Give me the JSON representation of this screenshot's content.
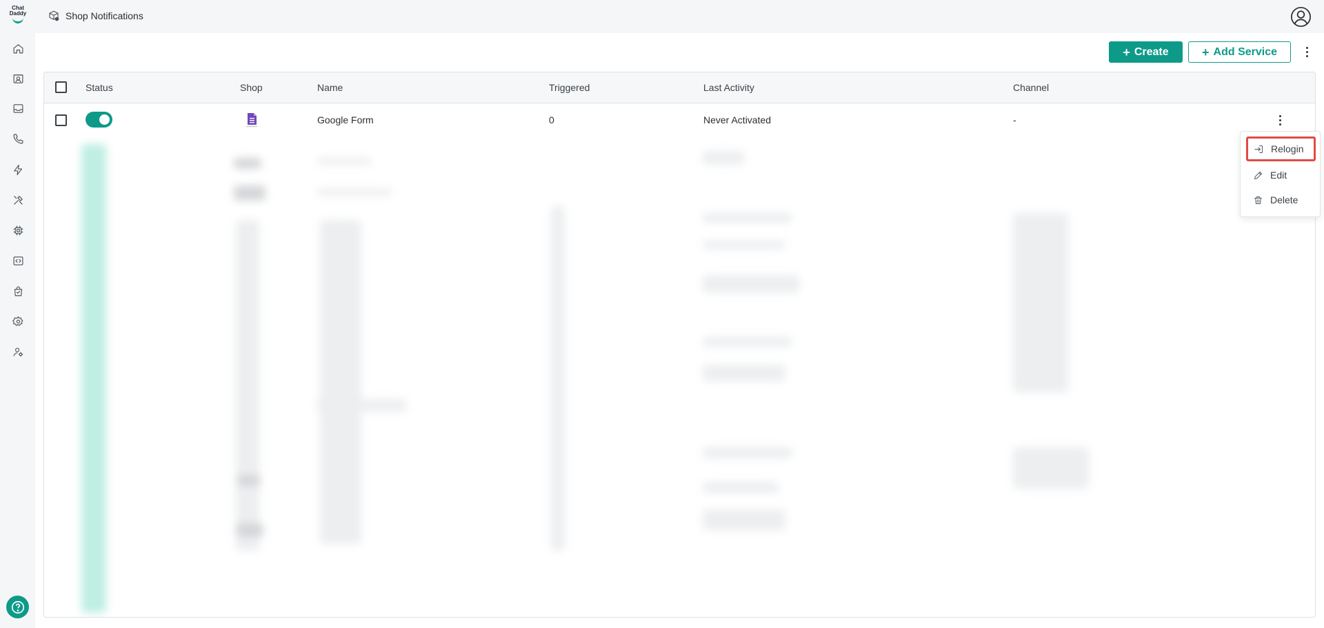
{
  "brand": {
    "logo_line1": "Chat",
    "logo_line2": "Daddy",
    "accent": "#0e9a88"
  },
  "sidebar": {
    "items": [
      {
        "name": "home-icon"
      },
      {
        "name": "contacts-icon"
      },
      {
        "name": "inbox-icon"
      },
      {
        "name": "phone-icon"
      },
      {
        "name": "automation-icon"
      },
      {
        "name": "tools-icon"
      },
      {
        "name": "chip-icon"
      },
      {
        "name": "code-icon"
      },
      {
        "name": "shop-bag-icon"
      },
      {
        "name": "settings-icon"
      },
      {
        "name": "team-icon"
      }
    ],
    "help": "help-icon"
  },
  "header": {
    "title": "Shop Notifications"
  },
  "toolbar": {
    "create_label": "Create",
    "add_service_label": "Add Service"
  },
  "table": {
    "columns": [
      "Status",
      "Shop",
      "Name",
      "Triggered",
      "Last Activity",
      "Channel"
    ],
    "rows": [
      {
        "status": "enabled",
        "shop": "Google Form",
        "name": "Google Form",
        "triggered": "0",
        "last_activity": "Never Activated",
        "channel": "-"
      }
    ]
  },
  "row_menu": {
    "items": [
      {
        "label": "Relogin",
        "icon": "relogin-icon",
        "highlighted": true
      },
      {
        "label": "Edit",
        "icon": "edit-icon"
      },
      {
        "label": "Delete",
        "icon": "trash-icon"
      }
    ]
  }
}
